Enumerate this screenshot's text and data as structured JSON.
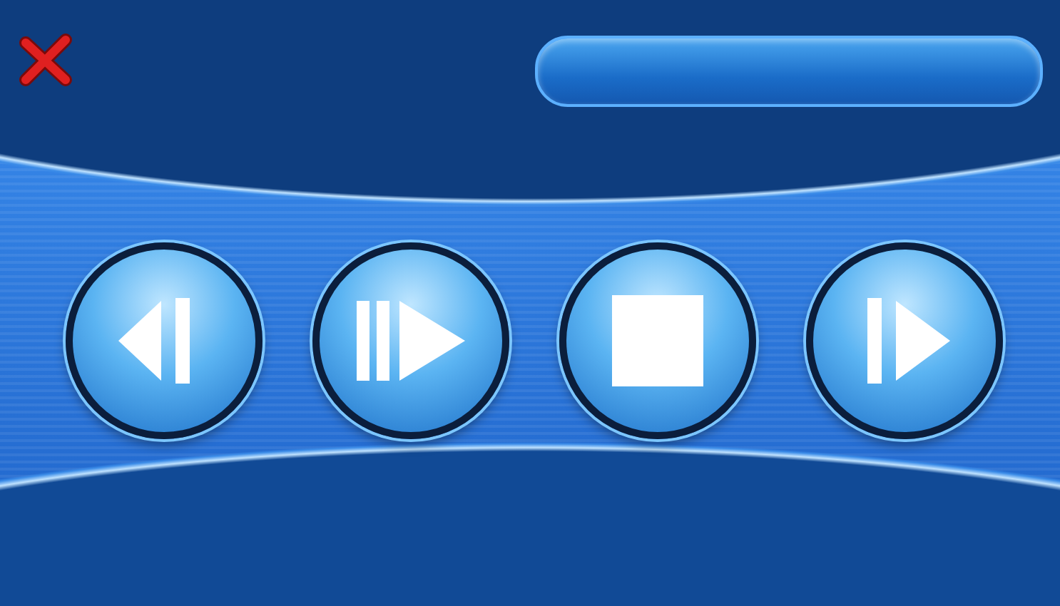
{
  "close_button": {
    "kind": "close"
  },
  "controls": [
    {
      "kind": "previous"
    },
    {
      "kind": "play_pause"
    },
    {
      "kind": "stop"
    },
    {
      "kind": "next"
    }
  ]
}
